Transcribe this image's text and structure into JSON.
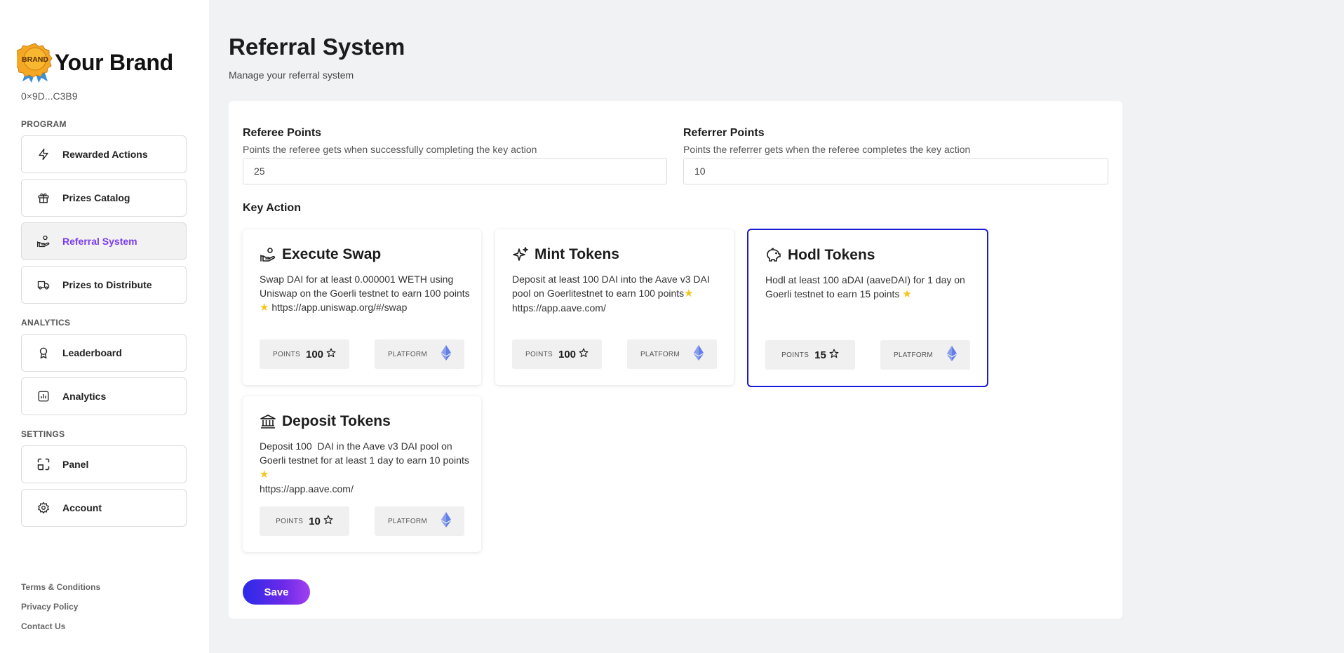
{
  "brand": {
    "name": "Your Brand",
    "logo_text": "BRAND"
  },
  "wallet": {
    "address": "0×9D...C3B9"
  },
  "sidebar": {
    "sections": {
      "program": "PROGRAM",
      "analytics": "ANALYTICS",
      "settings": "SETTINGS"
    },
    "items": [
      {
        "label": "Rewarded Actions",
        "icon": "lightning-icon"
      },
      {
        "label": "Prizes Catalog",
        "icon": "gift-icon"
      },
      {
        "label": "Referral System",
        "icon": "hand-coins-icon",
        "active": true
      },
      {
        "label": "Prizes to Distribute",
        "icon": "truck-icon"
      },
      {
        "label": "Leaderboard",
        "icon": "award-icon"
      },
      {
        "label": "Analytics",
        "icon": "chart-icon"
      },
      {
        "label": "Panel",
        "icon": "panel-icon"
      },
      {
        "label": "Account",
        "icon": "gear-icon"
      }
    ],
    "footer": [
      "Terms & Conditions",
      "Privacy Policy",
      "Contact Us"
    ]
  },
  "header": {
    "title": "Referral System",
    "subtitle": "Manage your referral system"
  },
  "form": {
    "referee": {
      "label": "Referee Points",
      "help": "Points the referee gets when successfully completing the key action",
      "value": "25"
    },
    "referrer": {
      "label": "Referrer Points",
      "help": "Points the referrer gets when the referee completes the key action",
      "value": "10"
    },
    "key_action_label": "Key Action",
    "save_label": "Save"
  },
  "actions": [
    {
      "title": "Execute Swap",
      "icon": "hand-coins-icon",
      "description": "Swap DAI for at least 0.000001 WETH using Uniswap on the Goerli testnet to earn 100 points",
      "link": "https://app.uniswap.org/#/swap",
      "points": "100",
      "selected": false
    },
    {
      "title": "Mint Tokens",
      "icon": "sparkles-icon",
      "description": "Deposit at least 100 DAI into the Aave v3 DAI pool on Goerlitestnet to earn 100 points",
      "link": "https://app.aave.com/",
      "points": "100",
      "selected": false
    },
    {
      "title": "Hodl Tokens",
      "icon": "piggy-bank-icon",
      "description": "Hodl at least 100 aDAI (aaveDAI) for 1 day on Goerli testnet to earn 15 points",
      "link": "",
      "points": "15",
      "selected": true
    },
    {
      "title": "Deposit Tokens",
      "icon": "bank-icon",
      "description": "Deposit 100  DAI in the Aave v3 DAI pool on Goerli testnet for at least 1 day to earn 10 points",
      "link": "https://app.aave.com/",
      "points": "10",
      "selected": false
    }
  ],
  "chip_labels": {
    "points": "POINTS",
    "platform": "PLATFORM"
  },
  "colors": {
    "accent": "#7a3cf0",
    "selected_border": "#1a1ad6",
    "star": "#f5c518",
    "ethereum": "#627eea"
  }
}
